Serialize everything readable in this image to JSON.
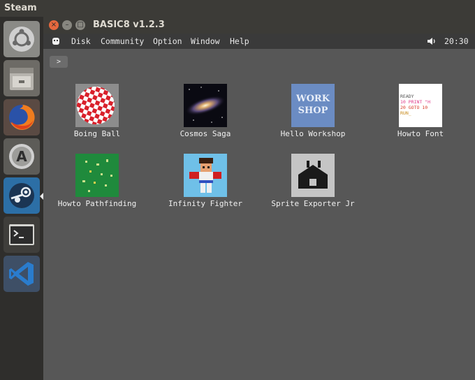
{
  "system_panel": {
    "title": "Steam"
  },
  "launcher": {
    "items": [
      {
        "name": "ubuntu-dash-icon"
      },
      {
        "name": "files-icon"
      },
      {
        "name": "firefox-icon"
      },
      {
        "name": "software-center-icon"
      },
      {
        "name": "steam-icon",
        "active": true
      },
      {
        "name": "terminal-icon"
      },
      {
        "name": "vscode-icon"
      }
    ]
  },
  "window": {
    "title": "BASIC8  v1.2.3",
    "buttons": {
      "close": "×",
      "minimize": "–",
      "maximize": "□"
    }
  },
  "menubar": {
    "items": [
      "Disk",
      "Community",
      "Option",
      "Window",
      "Help"
    ],
    "clock": "20:30"
  },
  "path": {
    "label": ">"
  },
  "programs": [
    {
      "label": "Boing Ball",
      "icon": "boing-ball-icon"
    },
    {
      "label": "Cosmos Saga",
      "icon": "galaxy-icon"
    },
    {
      "label": "Hello Workshop",
      "icon": "workshop-icon",
      "icon_text": [
        "WORK",
        "SHOP"
      ]
    },
    {
      "label": "Howto Font",
      "icon": "font-icon",
      "icon_text": [
        "READY",
        "10 PRINT \"H",
        "20 GOTO 10",
        "RUN_"
      ]
    },
    {
      "label": "Howto Pathfinding",
      "icon": "pathfinding-icon"
    },
    {
      "label": "Infinity Fighter",
      "icon": "fighter-icon"
    },
    {
      "label": "Sprite Exporter Jr",
      "icon": "sprite-exporter-icon"
    }
  ],
  "colors": {
    "panel": "#3c3b37",
    "launcher": "#2f2e2c",
    "window_bg": "#575757",
    "close_button": "#e5683e",
    "boing_red": "#d9202a",
    "workshop_blue": "#6b8cc3"
  }
}
